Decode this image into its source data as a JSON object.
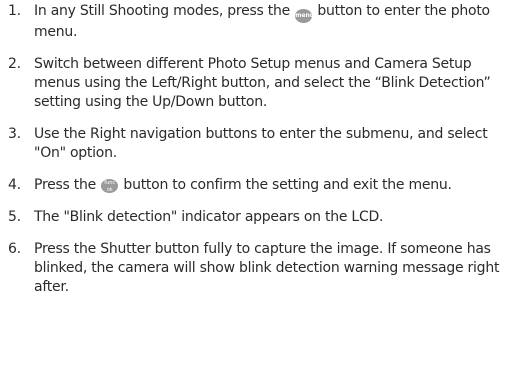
{
  "steps": [
    {
      "number": "1.",
      "text_before": "In any Still Shooting modes, press the ",
      "icon": "menu-button-icon",
      "icon_label": "menu",
      "text_after": " button to enter the photo menu."
    },
    {
      "number": "2.",
      "text": "Switch between different Photo Setup menus and Camera Setup menus using the Left/Right button, and select the “Blink Detection” setting using the Up/Down button."
    },
    {
      "number": "3.",
      "text": "Use the Right navigation buttons to enter the submenu, and select \"On\" option."
    },
    {
      "number": "4.",
      "text_before": "Press the ",
      "icon": "func-ok-button-icon",
      "icon_label_top": "func",
      "icon_label_bottom": "ok",
      "text_after": " button to confirm the setting and exit the menu."
    },
    {
      "number": "5.",
      "text": "The \"Blink detection\" indicator appears on the LCD."
    },
    {
      "number": "6.",
      "text": "Press the Shutter button fully to capture the image. If someone has blinked, the camera will show blink detection warning message right after."
    }
  ],
  "colors": {
    "text": "#2b2b2b",
    "icon_bg": "#9a9a9a"
  }
}
